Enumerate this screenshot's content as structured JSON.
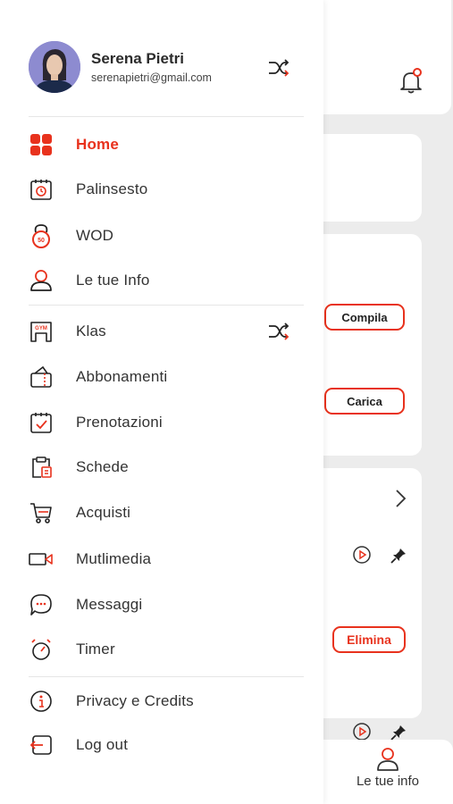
{
  "colors": {
    "accent": "#e8321d",
    "text": "#333333",
    "background": "#ececec"
  },
  "profile": {
    "name": "Serena Pietri",
    "email": "serenapietri@gmail.com"
  },
  "menu": {
    "main": [
      {
        "label": "Home",
        "icon": "grid-icon",
        "active": true
      },
      {
        "label": "Palinsesto",
        "icon": "calendar-clock-icon"
      },
      {
        "label": "WOD",
        "icon": "kettlebell-icon"
      },
      {
        "label": "Le tue Info",
        "icon": "user-icon"
      }
    ],
    "gym": [
      {
        "label": "Klas",
        "icon": "gym-icon"
      },
      {
        "label": "Abbonamenti",
        "icon": "card-icon"
      },
      {
        "label": "Prenotazioni",
        "icon": "calendar-check-icon"
      },
      {
        "label": "Schede",
        "icon": "clipboard-icon"
      },
      {
        "label": "Acquisti",
        "icon": "cart-icon"
      },
      {
        "label": "Mutlimedia",
        "icon": "video-icon"
      },
      {
        "label": "Messaggi",
        "icon": "chat-icon"
      },
      {
        "label": "Timer",
        "icon": "stopwatch-icon"
      }
    ],
    "footer": [
      {
        "label": "Privacy e Credits",
        "icon": "info-icon"
      },
      {
        "label": "Log out",
        "icon": "logout-icon"
      }
    ]
  },
  "background": {
    "compila_label": "Compila",
    "carica_label": "Carica",
    "elimina_label": "Elimina",
    "tab_label": "Le tue info"
  }
}
